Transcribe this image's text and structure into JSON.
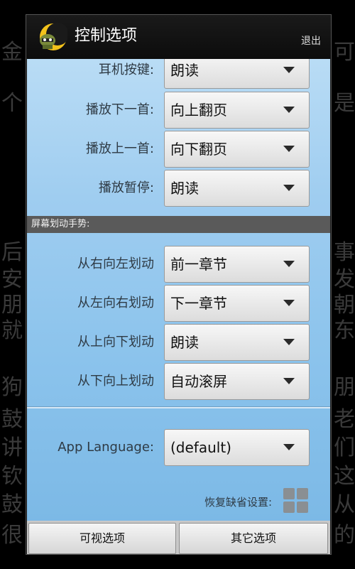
{
  "dialog": {
    "title": "控制选项",
    "exit_label": "退出"
  },
  "media_controls": [
    {
      "label": "耳机按键:",
      "value": "朗读"
    },
    {
      "label": "播放下一首:",
      "value": "向上翻页"
    },
    {
      "label": "播放上一首:",
      "value": "向下翻页"
    },
    {
      "label": "播放暂停:",
      "value": "朗读"
    }
  ],
  "gesture_section": {
    "header": "屏幕划动手势:",
    "items": [
      {
        "label": "从右向左划动",
        "value": "前一章节"
      },
      {
        "label": "从左向右划动",
        "value": "下一章节"
      },
      {
        "label": "从上向下划动",
        "value": "朗读"
      },
      {
        "label": "从下向上划动",
        "value": "自动滚屏"
      }
    ]
  },
  "language": {
    "label": "App Language:",
    "value": "(default)"
  },
  "restore": {
    "label": "恢复缺省设置:"
  },
  "bottom_buttons": {
    "visual": "可视选项",
    "other": "其它选项"
  },
  "background_text": {
    "left": [
      "金",
      "个",
      "后",
      "安",
      "朋",
      "就",
      "狗",
      "鼓",
      "讲",
      "钦",
      "鼓",
      "很"
    ],
    "right": [
      "可",
      "是",
      "事",
      "发",
      "朝",
      "东",
      "朋",
      "老",
      "们",
      "这",
      "从",
      "的"
    ]
  },
  "colors": {
    "content_bg": "#8bc3ec",
    "section_header": "#5a5a5a"
  }
}
